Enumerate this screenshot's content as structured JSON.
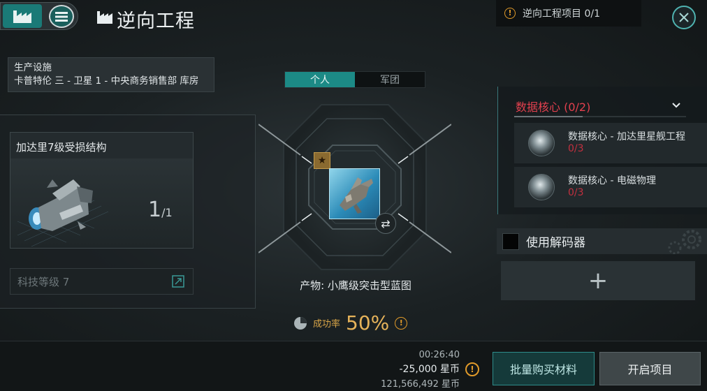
{
  "header": {
    "title": "逆向工程",
    "project_count": "逆向工程项目 0/1",
    "icons": {
      "factory": "factory-icon",
      "menu": "menu-icon",
      "close": "close-icon",
      "warning": "warning-icon"
    }
  },
  "facility": {
    "label": "生产设施",
    "location": "卡普特伦 三 - 卫星 1 - 中央商务销售部 库房"
  },
  "input_item": {
    "name": "加达里7级受损结构",
    "qty_main": "1",
    "qty_total": "/1"
  },
  "tech_level": {
    "label": "科技等级 7"
  },
  "tabs": [
    {
      "label": "个人",
      "active": true
    },
    {
      "label": "军团",
      "active": false
    }
  ],
  "product": {
    "label": "产物: 小鹰级突击型蓝图",
    "badge_icon": "star-icon",
    "swap_icon": "swap-icon"
  },
  "success_rate": {
    "label": "成功率",
    "value": "50%"
  },
  "data_cores": {
    "header": "数据核心 (0/2)",
    "items": [
      {
        "name": "数据核心 - 加达里星舰工程",
        "count": "0/3"
      },
      {
        "name": "数据核心 - 电磁物理",
        "count": "0/3"
      }
    ]
  },
  "decoder": {
    "label": "使用解码器",
    "add_symbol": "+"
  },
  "cost": {
    "time": "00:26:40",
    "price": "-25,000 星币",
    "balance": "121,566,492 星币"
  },
  "buttons": {
    "buy_materials": "批量购买材料",
    "start_project": "开启项目"
  },
  "colors": {
    "accent": "#1c8a86",
    "warning": "#e09a2a",
    "alert": "#e2404e",
    "gold": "#e6b35a"
  }
}
